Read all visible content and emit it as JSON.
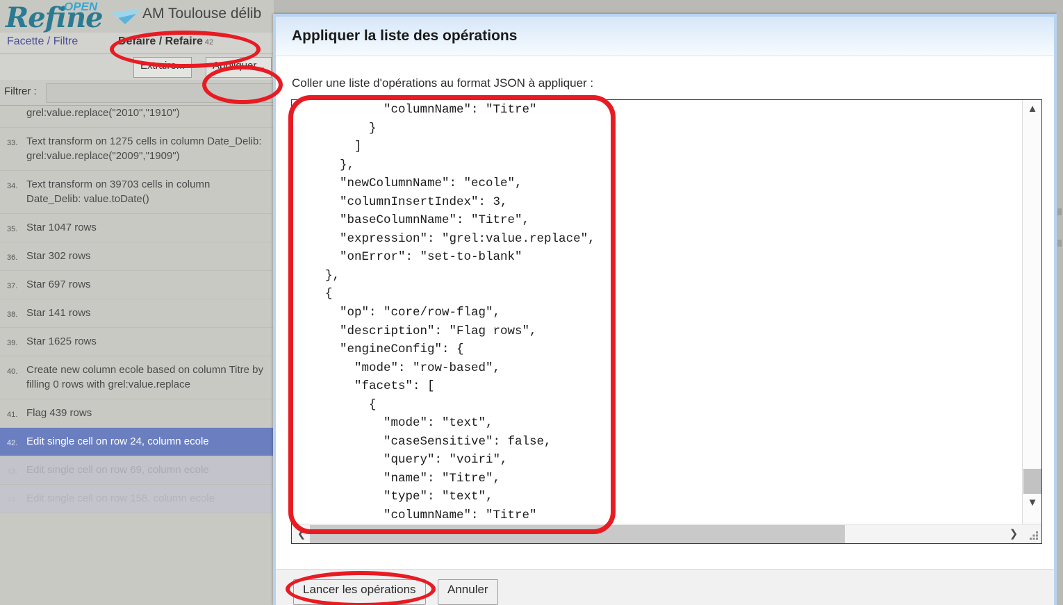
{
  "app": {
    "logo_refine": "Refine",
    "logo_open": "OPEN",
    "logo_gem_icon": "diamond-icon",
    "project_title": "AM Toulouse délib"
  },
  "tabs": [
    {
      "label": "Facette / Filtre",
      "name": "tab-facette-filtre",
      "active": false
    },
    {
      "label": "Défaire / Refaire",
      "name": "tab-defaire-refaire",
      "active": true,
      "count": "42"
    }
  ],
  "history_toolbar": {
    "extract_label": "Extraire...",
    "apply_label": "Appliquer..."
  },
  "filter": {
    "label": "Filtrer :",
    "value": "",
    "placeholder": ""
  },
  "history": [
    {
      "num": "",
      "text": "grel:value.replace(\"2010\",\"1910\")",
      "state": "partial"
    },
    {
      "num": "33.",
      "text": "Text transform on 1275 cells in column Date_Delib: grel:value.replace(\"2009\",\"1909\")",
      "state": "normal"
    },
    {
      "num": "34.",
      "text": "Text transform on 39703 cells in column Date_Delib: value.toDate()",
      "state": "normal"
    },
    {
      "num": "35.",
      "text": "Star 1047 rows",
      "state": "normal"
    },
    {
      "num": "36.",
      "text": "Star 302 rows",
      "state": "normal"
    },
    {
      "num": "37.",
      "text": "Star 697 rows",
      "state": "normal"
    },
    {
      "num": "38.",
      "text": "Star 141 rows",
      "state": "normal"
    },
    {
      "num": "39.",
      "text": "Star 1625 rows",
      "state": "normal"
    },
    {
      "num": "40.",
      "text": "Create new column ecole based on column Titre by filling 0 rows with grel:value.replace",
      "state": "normal"
    },
    {
      "num": "41.",
      "text": "Flag 439 rows",
      "state": "normal"
    },
    {
      "num": "42.",
      "text": "Edit single cell on row 24, column ecole",
      "state": "selected"
    },
    {
      "num": "43.",
      "text": "Edit single cell on row 69, column ecole",
      "state": "dim1"
    },
    {
      "num": "44.",
      "text": "Edit single cell on row 158, column ecole",
      "state": "dim2"
    }
  ],
  "dialog": {
    "title": "Appliquer la liste des opérations",
    "paste_label": "Coller une liste d'opérations au format JSON à appliquer :",
    "json_value": "            \"columnName\": \"Titre\"\n          }\n        ]\n      },\n      \"newColumnName\": \"ecole\",\n      \"columnInsertIndex\": 3,\n      \"baseColumnName\": \"Titre\",\n      \"expression\": \"grel:value.replace\",\n      \"onError\": \"set-to-blank\"\n    },\n    {\n      \"op\": \"core/row-flag\",\n      \"description\": \"Flag rows\",\n      \"engineConfig\": {\n        \"mode\": \"row-based\",\n        \"facets\": [\n          {\n            \"mode\": \"text\",\n            \"caseSensitive\": false,\n            \"query\": \"voiri\",\n            \"name\": \"Titre\",\n            \"type\": \"text\",\n            \"columnName\": \"Titre\"\n          }\n        ]\n      },\n      \"flagged\": true\n    }\n  ]",
    "run_label": "Lancer les opérations",
    "cancel_label": "Annuler",
    "scroll_up_icon": "chevron-up-icon",
    "scroll_down_icon": "chevron-down-icon",
    "scroll_left_icon": "chevron-left-icon",
    "scroll_right_icon": "chevron-right-icon",
    "resize_grip_icon": "resize-grip-icon"
  },
  "annotations": {
    "color": "#e81b23",
    "highlights": [
      "tab-defaire-refaire",
      "apply-operations-button",
      "json-textarea",
      "run-operations-button"
    ]
  }
}
